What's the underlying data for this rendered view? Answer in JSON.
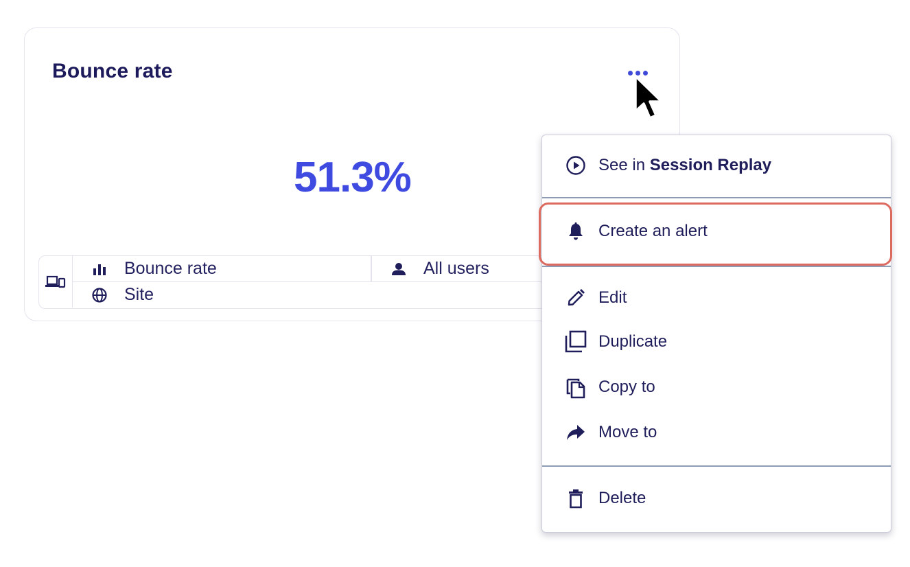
{
  "card": {
    "title": "Bounce rate",
    "value": "51.3%",
    "more_icon": "more-horizontal-icon",
    "segments": {
      "device_icon": "devices-icon",
      "metric": {
        "icon": "bar-chart-icon",
        "label": "Bounce rate"
      },
      "users": {
        "icon": "user-icon",
        "label": "All users"
      },
      "scope": {
        "icon": "globe-icon",
        "label": "Site"
      }
    }
  },
  "menu": {
    "session_replay": {
      "icon": "play-circle-icon",
      "prefix": "See in ",
      "bold": "Session Replay"
    },
    "create_alert": {
      "icon": "bell-icon",
      "label": "Create an alert"
    },
    "edit": {
      "icon": "pencil-icon",
      "label": "Edit"
    },
    "duplicate": {
      "icon": "duplicate-icon",
      "label": "Duplicate"
    },
    "copy_to": {
      "icon": "copy-icon",
      "label": "Copy to"
    },
    "move_to": {
      "icon": "share-arrow-icon",
      "label": "Move to"
    },
    "delete": {
      "icon": "trash-icon",
      "label": "Delete"
    }
  },
  "colors": {
    "title": "#1c1a5b",
    "accent": "#3f4ae0",
    "highlight": "#dd6a5f",
    "border": "#e3e4ee"
  }
}
